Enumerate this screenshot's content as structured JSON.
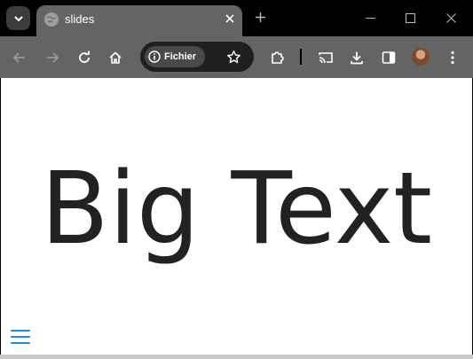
{
  "tab": {
    "title": "slides"
  },
  "omnibox": {
    "site_chip_label": "Fichier"
  },
  "slide": {
    "text": "Big Text"
  },
  "icons": {
    "tab_search": "chevron-down-icon",
    "favicon": "globe-icon",
    "tab_close": "close-icon",
    "new_tab": "plus-icon",
    "minimize": "minimize-icon",
    "maximize": "maximize-icon",
    "close_window": "close-icon",
    "back": "arrow-left-icon",
    "forward": "arrow-right-icon",
    "reload": "reload-icon",
    "home": "home-icon",
    "info": "info-icon",
    "bookmark": "star-icon",
    "extensions": "puzzle-icon",
    "cast": "cast-icon",
    "download": "download-icon",
    "side_panel": "side-panel-icon",
    "avatar": "avatar",
    "menu": "kebab-menu-icon",
    "slide_menu": "hamburger-menu-icon"
  },
  "colors": {
    "chrome_frame": "#000000",
    "toolbar": "#646464",
    "tab_active": "#646464",
    "omnibox": "#1f1f1f",
    "slide_text": "#222222",
    "menu_accent": "#1e88e5"
  }
}
